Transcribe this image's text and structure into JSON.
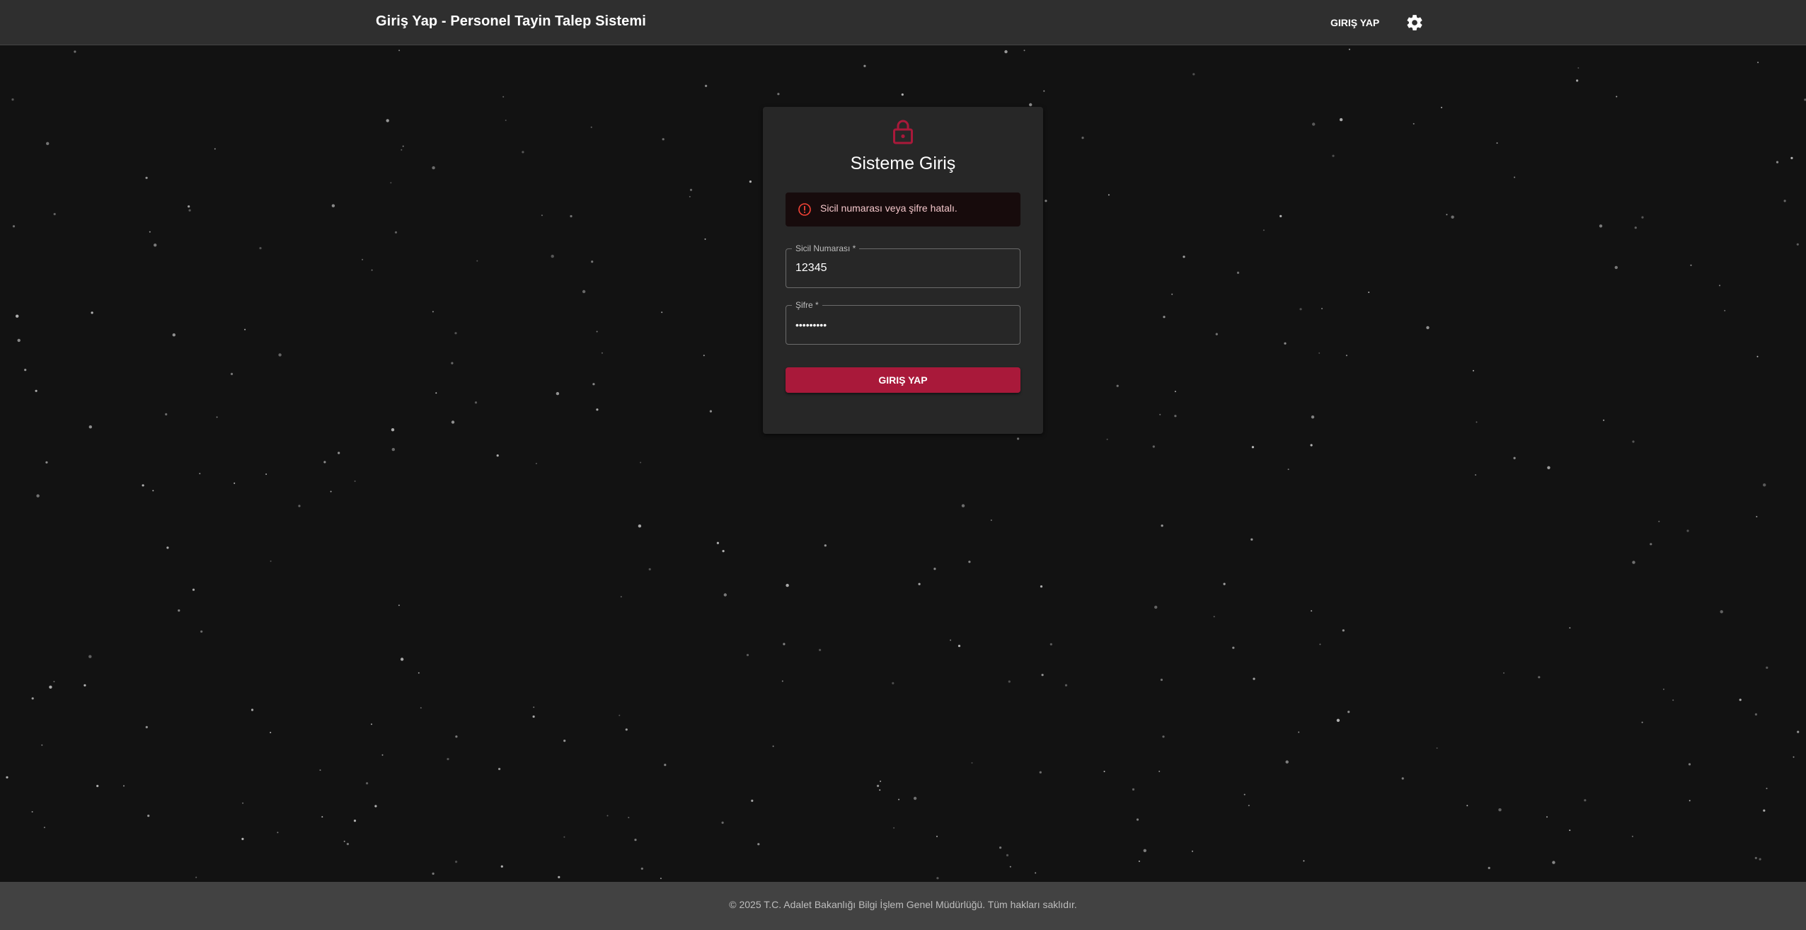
{
  "header": {
    "title": "Giriş Yap - Personel Tayin Talep Sistemi",
    "login_label": "GIRIŞ YAP",
    "settings_icon": "gear-icon"
  },
  "login_card": {
    "lock_icon": "lock-icon",
    "title": "Sisteme Giriş",
    "alert": {
      "icon": "error-outline-icon",
      "message": "Sicil numarası veya şifre hatalı."
    },
    "fields": {
      "registry_number": {
        "label": "Sicil Numarası *",
        "value": "12345"
      },
      "password": {
        "label": "Şifre *",
        "value": "•••••••••"
      }
    },
    "submit_label": "GIRIŞ YAP"
  },
  "footer": {
    "copyright": "© 2025 T.C. Adalet Bakanlığı Bilgi İşlem Genel Müdürlüğü. Tüm hakları saklıdır."
  },
  "colors": {
    "accent": "#a9193a",
    "alert_background": "#170b0c",
    "alert_text": "#f4c7cb",
    "background": "#121212",
    "topbar": "#2f2f2f",
    "card": "#272727",
    "footer": "#424242"
  }
}
